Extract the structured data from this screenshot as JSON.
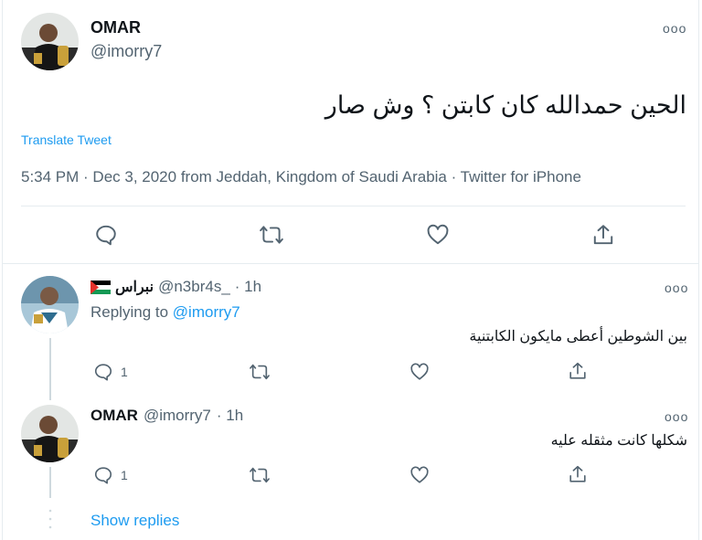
{
  "main_tweet": {
    "author_name": "OMAR",
    "author_handle": "@imorry7",
    "text": "الحين حمدالله كان كابتن ؟ وش صار",
    "translate_label": "Translate Tweet",
    "meta": "5:34 PM · Dec 3, 2020 from Jeddah, Kingdom of Saudi Arabia · Twitter for iPhone",
    "more_label": "ooo"
  },
  "replies": [
    {
      "author_name": "نبراس",
      "author_handle": "@n3br4s_",
      "time": "· 1h",
      "replying_prefix": "Replying to",
      "replying_handle": "@imorry7",
      "text": "بين الشوطين أعطى مايكون الكابتنية",
      "reply_count": "1",
      "more_label": "ooo"
    },
    {
      "author_name": "OMAR",
      "author_handle": "@imorry7",
      "time": "· 1h",
      "text": "شكلها كانت مثقله عليه",
      "reply_count": "1",
      "more_label": "ooo"
    }
  ],
  "show_replies_label": "Show replies",
  "colors": {
    "accent": "#1d9bf0",
    "secondary_text": "#536471",
    "divider": "#e6ecf0"
  },
  "icons": [
    "reply-icon",
    "retweet-icon",
    "like-icon",
    "share-icon",
    "palestine-flag-icon"
  ]
}
